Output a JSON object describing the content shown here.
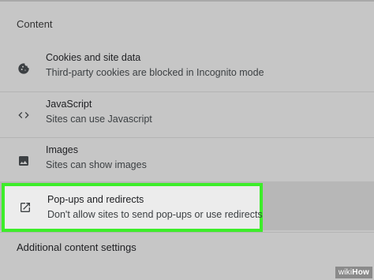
{
  "section": {
    "title": "Content"
  },
  "rows": [
    {
      "title": "Cookies and site data",
      "subtitle": "Third-party cookies are blocked in Incognito mode",
      "icon": "cookie-icon"
    },
    {
      "title": "JavaScript",
      "subtitle": "Sites can use Javascript",
      "icon": "code-icon"
    },
    {
      "title": "Images",
      "subtitle": "Sites can show images",
      "icon": "image-icon"
    },
    {
      "title": "Pop-ups and redirects",
      "subtitle": "Don't allow sites to send pop-ups or use redirects",
      "icon": "open-in-new-icon"
    }
  ],
  "additional_label": "Additional content settings",
  "watermark": {
    "wiki": "wiki",
    "how": "How"
  },
  "colors": {
    "highlight": "#3ded2a",
    "background": "#c6c6c6"
  }
}
